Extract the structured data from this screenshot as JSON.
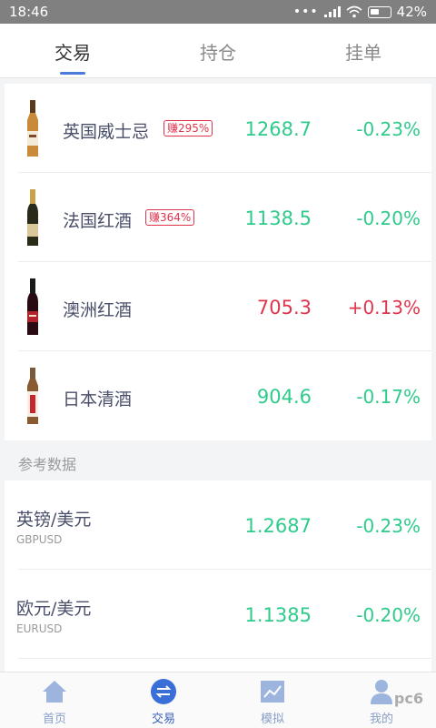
{
  "status_bar": {
    "time": "18:46",
    "battery": "42%"
  },
  "top_tabs": [
    {
      "label": "交易",
      "active": true
    },
    {
      "label": "持仓",
      "active": false
    },
    {
      "label": "挂单",
      "active": false
    }
  ],
  "products": [
    {
      "name": "英国威士忌",
      "earn": "赚295%",
      "price": "1268.7",
      "change": "-0.23%",
      "trend": "down",
      "icon": "whisky-bottle-icon"
    },
    {
      "name": "法国红酒",
      "earn": "赚364%",
      "price": "1138.5",
      "change": "-0.20%",
      "trend": "down",
      "icon": "red-wine-bottle-icon"
    },
    {
      "name": "澳洲红酒",
      "earn": "",
      "price": "705.3",
      "change": "+0.13%",
      "trend": "up",
      "icon": "wine-bottle-icon"
    },
    {
      "name": "日本清酒",
      "earn": "",
      "price": "904.6",
      "change": "-0.17%",
      "trend": "down",
      "icon": "sake-bottle-icon"
    }
  ],
  "reference": {
    "title": "参考数据",
    "rows": [
      {
        "name": "英镑/美元",
        "code": "GBPUSD",
        "price": "1.2687",
        "change": "-0.23%",
        "trend": "down"
      },
      {
        "name": "欧元/美元",
        "code": "EURUSD",
        "price": "1.1385",
        "change": "-0.20%",
        "trend": "down"
      }
    ]
  },
  "bottom_nav": [
    {
      "label": "首页",
      "icon": "home-icon",
      "active": false
    },
    {
      "label": "交易",
      "icon": "exchange-icon",
      "active": true
    },
    {
      "label": "模拟",
      "icon": "chart-icon",
      "active": false
    },
    {
      "label": "我的",
      "icon": "user-icon",
      "active": false
    }
  ],
  "watermark": "pc6",
  "colors": {
    "up": "#e0344d",
    "down": "#2ecb8a",
    "accent": "#4a7bdc"
  }
}
